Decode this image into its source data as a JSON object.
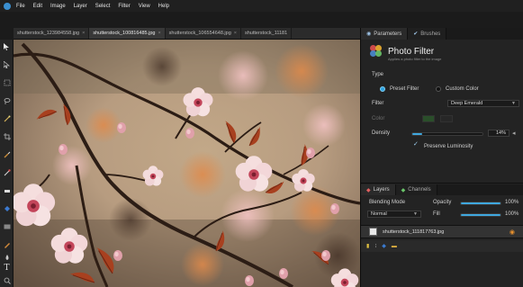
{
  "menu": {
    "items": [
      "File",
      "Edit",
      "Image",
      "Layer",
      "Select",
      "Filter",
      "View",
      "Help"
    ]
  },
  "documents": {
    "tabs": [
      {
        "label": "shutterstock_123984558.jpg",
        "close": "×"
      },
      {
        "label": "shutterstock_100816485.jpg",
        "close": "×"
      },
      {
        "label": "shutterstock_106554648.jpg",
        "close": "×"
      },
      {
        "label": "shutterstock_11181",
        "close": ""
      }
    ]
  },
  "tools": {
    "icons": [
      "move-tool-icon",
      "selection-arrow-icon",
      "marquee-icon",
      "lasso-icon",
      "wand-icon",
      "crop-icon",
      "brush-icon",
      "eyedropper-icon",
      "eraser-icon",
      "paint-bucket-icon",
      "gradient-icon",
      "pen-icon",
      "blur-icon",
      "dodge-icon",
      "type-icon",
      "zoom-icon"
    ]
  },
  "panel": {
    "tabs": {
      "parameters": "Parameters",
      "brushes": "Brushes"
    },
    "filter_title": "Photo Filter",
    "filter_subtitle": "Applies a photo filter to the image",
    "type_label": "Type",
    "preset_filter_label": "Preset Filter",
    "custom_color_label": "Custom Color",
    "filter_label": "Filter",
    "filter_value": "Deep Emerald",
    "color_label": "Color",
    "density_label": "Density",
    "density_value": "14%",
    "density_fraction": 0.14,
    "preserve_luminosity_label": "Preserve Luminosity",
    "preserve_luminosity_checked": true,
    "accent_color": "#3fa8df"
  },
  "layers": {
    "tabs": {
      "layers": "Layers",
      "channels": "Channels"
    },
    "blending_mode_label": "Blending Mode",
    "blending_mode_value": "Normal",
    "opacity_label": "Opacity",
    "opacity_value": "100%",
    "fill_label": "Fill",
    "fill_value": "100%",
    "layer_name": "shutterstock_111817763.jpg"
  }
}
